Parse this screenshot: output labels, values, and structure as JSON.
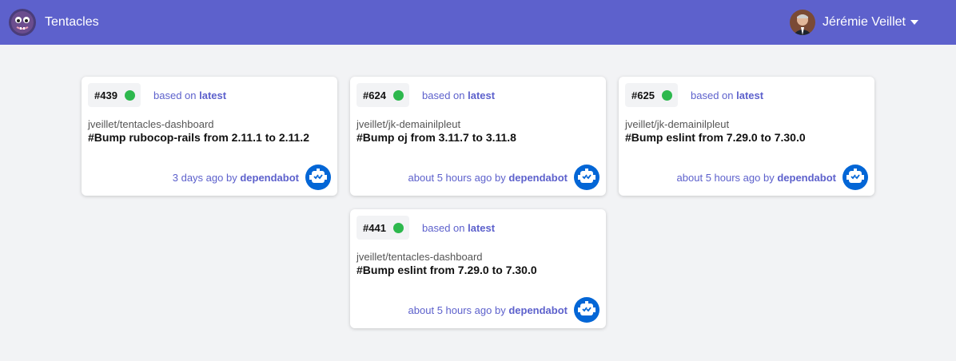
{
  "header": {
    "brand_name": "Tentacles",
    "logo_icon": "octopus-logo-icon",
    "user_name": "Jérémie Veillet",
    "accent_color": "#5d61cc"
  },
  "cards": [
    {
      "number": "#439",
      "status": "success",
      "based_on_prefix": "based on",
      "branch": "latest",
      "repo": "jveillet/tentacles-dashboard",
      "title": "#Bump rubocop-rails from 2.11.1 to 2.11.2",
      "time": "3 days ago by",
      "author": "dependabot"
    },
    {
      "number": "#624",
      "status": "success",
      "based_on_prefix": "based on",
      "branch": "latest",
      "repo": "jveillet/jk-demainilpleut",
      "title": "#Bump oj from 3.11.7 to 3.11.8",
      "time": "about 5 hours ago by",
      "author": "dependabot"
    },
    {
      "number": "#625",
      "status": "success",
      "based_on_prefix": "based on",
      "branch": "latest",
      "repo": "jveillet/jk-demainilpleut",
      "title": "#Bump eslint from 7.29.0 to 7.30.0",
      "time": "about 5 hours ago by",
      "author": "dependabot"
    },
    {
      "number": "#441",
      "status": "success",
      "based_on_prefix": "based on",
      "branch": "latest",
      "repo": "jveillet/tentacles-dashboard",
      "title": "#Bump eslint from 7.29.0 to 7.30.0",
      "time": "about 5 hours ago by",
      "author": "dependabot"
    }
  ]
}
